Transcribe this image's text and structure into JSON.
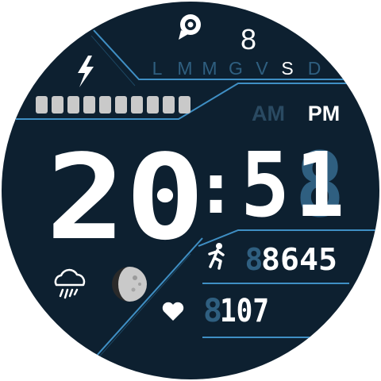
{
  "colors": {
    "background": "#0d2030",
    "accent": "#3f8fc4",
    "dim_accent": "#1d4661",
    "text": "#ffffff",
    "dim_text": "#2f5f80",
    "inactive_ampm": "#2a4a62"
  },
  "icons": {
    "notification": "notification-icon",
    "charge": "lightning-icon",
    "weather": "rain-cloud-icon",
    "moon": "moon-phase-icon",
    "steps": "running-person-icon",
    "heart": "heart-icon"
  },
  "notification_count": "8",
  "weekdays": [
    {
      "label": "L",
      "active": false
    },
    {
      "label": "M",
      "active": false
    },
    {
      "label": "M",
      "active": false
    },
    {
      "label": "G",
      "active": false
    },
    {
      "label": "V",
      "active": false
    },
    {
      "label": "S",
      "active": true
    },
    {
      "label": "D",
      "active": false
    }
  ],
  "battery": {
    "segments_total": 10,
    "segments_filled": 10
  },
  "ampm": {
    "am": "AM",
    "pm": "PM",
    "active": "pm"
  },
  "time": {
    "hours": "20",
    "separator": ":",
    "minutes_left": "5",
    "minutes_right": "1",
    "minutes_right_ghost": "8"
  },
  "steps": {
    "ghost": "8",
    "value": "8645"
  },
  "heart_rate": {
    "ghost": "8",
    "value": "107"
  }
}
